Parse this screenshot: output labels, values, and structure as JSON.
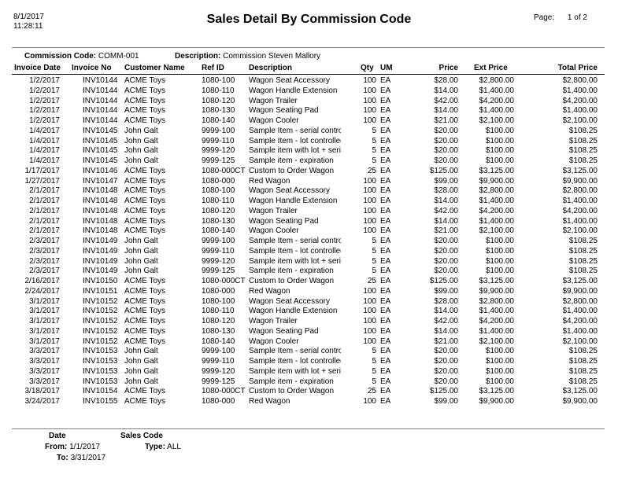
{
  "report": {
    "print_date": "8/1/2017",
    "print_time": "11:28:11",
    "title": "Sales Detail By Commission Code",
    "page_label": "Page:",
    "page_number": "1",
    "page_of": "of",
    "page_total": "2"
  },
  "commission": {
    "code_label": "Commission Code:",
    "code_value": "COMM-001",
    "desc_label": "Description:",
    "desc_value": "Commission Steven Mallory"
  },
  "columns": {
    "invoice_date": "Invoice Date",
    "invoice_no": "Invoice No",
    "customer_name": "Customer Name",
    "ref_id": "Ref ID",
    "description": "Description",
    "qty": "Qty",
    "um": "UM",
    "price": "Price",
    "ext_price": "Ext Price",
    "total_price": "Total Price"
  },
  "rows": [
    {
      "date": "1/2/2017",
      "inv": "INV10144",
      "cust": "ACME Toys",
      "ref": "1080-100",
      "desc": "Wagon Seat Accessory",
      "qty": "100",
      "um": "EA",
      "price": "$28.00",
      "ext": "$2,800.00",
      "total": "$2,800.00"
    },
    {
      "date": "1/2/2017",
      "inv": "INV10144",
      "cust": "ACME Toys",
      "ref": "1080-110",
      "desc": "Wagon Handle Extension",
      "qty": "100",
      "um": "EA",
      "price": "$14.00",
      "ext": "$1,400.00",
      "total": "$1,400.00"
    },
    {
      "date": "1/2/2017",
      "inv": "INV10144",
      "cust": "ACME Toys",
      "ref": "1080-120",
      "desc": "Wagon Trailer",
      "qty": "100",
      "um": "EA",
      "price": "$42.00",
      "ext": "$4,200.00",
      "total": "$4,200.00"
    },
    {
      "date": "1/2/2017",
      "inv": "INV10144",
      "cust": "ACME Toys",
      "ref": "1080-130",
      "desc": "Wagon Seating Pad",
      "qty": "100",
      "um": "EA",
      "price": "$14.00",
      "ext": "$1,400.00",
      "total": "$1,400.00"
    },
    {
      "date": "1/2/2017",
      "inv": "INV10144",
      "cust": "ACME Toys",
      "ref": "1080-140",
      "desc": "Wagon Cooler",
      "qty": "100",
      "um": "EA",
      "price": "$21.00",
      "ext": "$2,100.00",
      "total": "$2,100.00"
    },
    {
      "date": "1/4/2017",
      "inv": "INV10145",
      "cust": "John Galt",
      "ref": "9999-100",
      "desc": "Sample Item - serial control",
      "qty": "5",
      "um": "EA",
      "price": "$20.00",
      "ext": "$100.00",
      "total": "$108.25"
    },
    {
      "date": "1/4/2017",
      "inv": "INV10145",
      "cust": "John Galt",
      "ref": "9999-110",
      "desc": "Sample Item - lot controlled",
      "qty": "5",
      "um": "EA",
      "price": "$20.00",
      "ext": "$100.00",
      "total": "$108.25"
    },
    {
      "date": "1/4/2017",
      "inv": "INV10145",
      "cust": "John Galt",
      "ref": "9999-120",
      "desc": "Sample item with lot + serial",
      "qty": "5",
      "um": "EA",
      "price": "$20.00",
      "ext": "$100.00",
      "total": "$108.25"
    },
    {
      "date": "1/4/2017",
      "inv": "INV10145",
      "cust": "John Galt",
      "ref": "9999-125",
      "desc": "Sample item - expiration",
      "qty": "5",
      "um": "EA",
      "price": "$20.00",
      "ext": "$100.00",
      "total": "$108.25"
    },
    {
      "date": "1/17/2017",
      "inv": "INV10146",
      "cust": "ACME Toys",
      "ref": "1080-000CT",
      "desc": "Custom to Order Wagon",
      "qty": "25",
      "um": "EA",
      "price": "$125.00",
      "ext": "$3,125.00",
      "total": "$3,125.00"
    },
    {
      "date": "1/27/2017",
      "inv": "INV10147",
      "cust": "ACME Toys",
      "ref": "1080-000",
      "desc": "Red Wagon",
      "qty": "100",
      "um": "EA",
      "price": "$99.00",
      "ext": "$9,900.00",
      "total": "$9,900.00"
    },
    {
      "date": "2/1/2017",
      "inv": "INV10148",
      "cust": "ACME Toys",
      "ref": "1080-100",
      "desc": "Wagon Seat Accessory",
      "qty": "100",
      "um": "EA",
      "price": "$28.00",
      "ext": "$2,800.00",
      "total": "$2,800.00"
    },
    {
      "date": "2/1/2017",
      "inv": "INV10148",
      "cust": "ACME Toys",
      "ref": "1080-110",
      "desc": "Wagon Handle Extension",
      "qty": "100",
      "um": "EA",
      "price": "$14.00",
      "ext": "$1,400.00",
      "total": "$1,400.00"
    },
    {
      "date": "2/1/2017",
      "inv": "INV10148",
      "cust": "ACME Toys",
      "ref": "1080-120",
      "desc": "Wagon Trailer",
      "qty": "100",
      "um": "EA",
      "price": "$42.00",
      "ext": "$4,200.00",
      "total": "$4,200.00"
    },
    {
      "date": "2/1/2017",
      "inv": "INV10148",
      "cust": "ACME Toys",
      "ref": "1080-130",
      "desc": "Wagon Seating Pad",
      "qty": "100",
      "um": "EA",
      "price": "$14.00",
      "ext": "$1,400.00",
      "total": "$1,400.00"
    },
    {
      "date": "2/1/2017",
      "inv": "INV10148",
      "cust": "ACME Toys",
      "ref": "1080-140",
      "desc": "Wagon Cooler",
      "qty": "100",
      "um": "EA",
      "price": "$21.00",
      "ext": "$2,100.00",
      "total": "$2,100.00"
    },
    {
      "date": "2/3/2017",
      "inv": "INV10149",
      "cust": "John Galt",
      "ref": "9999-100",
      "desc": "Sample Item - serial control",
      "qty": "5",
      "um": "EA",
      "price": "$20.00",
      "ext": "$100.00",
      "total": "$108.25"
    },
    {
      "date": "2/3/2017",
      "inv": "INV10149",
      "cust": "John Galt",
      "ref": "9999-110",
      "desc": "Sample Item - lot controlled",
      "qty": "5",
      "um": "EA",
      "price": "$20.00",
      "ext": "$100.00",
      "total": "$108.25"
    },
    {
      "date": "2/3/2017",
      "inv": "INV10149",
      "cust": "John Galt",
      "ref": "9999-120",
      "desc": "Sample item with lot + serial",
      "qty": "5",
      "um": "EA",
      "price": "$20.00",
      "ext": "$100.00",
      "total": "$108.25"
    },
    {
      "date": "2/3/2017",
      "inv": "INV10149",
      "cust": "John Galt",
      "ref": "9999-125",
      "desc": "Sample item - expiration",
      "qty": "5",
      "um": "EA",
      "price": "$20.00",
      "ext": "$100.00",
      "total": "$108.25"
    },
    {
      "date": "2/16/2017",
      "inv": "INV10150",
      "cust": "ACME Toys",
      "ref": "1080-000CT",
      "desc": "Custom to Order Wagon",
      "qty": "25",
      "um": "EA",
      "price": "$125.00",
      "ext": "$3,125.00",
      "total": "$3,125.00"
    },
    {
      "date": "2/24/2017",
      "inv": "INV10151",
      "cust": "ACME Toys",
      "ref": "1080-000",
      "desc": "Red Wagon",
      "qty": "100",
      "um": "EA",
      "price": "$99.00",
      "ext": "$9,900.00",
      "total": "$9,900.00"
    },
    {
      "date": "3/1/2017",
      "inv": "INV10152",
      "cust": "ACME Toys",
      "ref": "1080-100",
      "desc": "Wagon Seat Accessory",
      "qty": "100",
      "um": "EA",
      "price": "$28.00",
      "ext": "$2,800.00",
      "total": "$2,800.00"
    },
    {
      "date": "3/1/2017",
      "inv": "INV10152",
      "cust": "ACME Toys",
      "ref": "1080-110",
      "desc": "Wagon Handle Extension",
      "qty": "100",
      "um": "EA",
      "price": "$14.00",
      "ext": "$1,400.00",
      "total": "$1,400.00"
    },
    {
      "date": "3/1/2017",
      "inv": "INV10152",
      "cust": "ACME Toys",
      "ref": "1080-120",
      "desc": "Wagon Trailer",
      "qty": "100",
      "um": "EA",
      "price": "$42.00",
      "ext": "$4,200.00",
      "total": "$4,200.00"
    },
    {
      "date": "3/1/2017",
      "inv": "INV10152",
      "cust": "ACME Toys",
      "ref": "1080-130",
      "desc": "Wagon Seating Pad",
      "qty": "100",
      "um": "EA",
      "price": "$14.00",
      "ext": "$1,400.00",
      "total": "$1,400.00"
    },
    {
      "date": "3/1/2017",
      "inv": "INV10152",
      "cust": "ACME Toys",
      "ref": "1080-140",
      "desc": "Wagon Cooler",
      "qty": "100",
      "um": "EA",
      "price": "$21.00",
      "ext": "$2,100.00",
      "total": "$2,100.00"
    },
    {
      "date": "3/3/2017",
      "inv": "INV10153",
      "cust": "John Galt",
      "ref": "9999-100",
      "desc": "Sample Item - serial control",
      "qty": "5",
      "um": "EA",
      "price": "$20.00",
      "ext": "$100.00",
      "total": "$108.25"
    },
    {
      "date": "3/3/2017",
      "inv": "INV10153",
      "cust": "John Galt",
      "ref": "9999-110",
      "desc": "Sample Item - lot controlled",
      "qty": "5",
      "um": "EA",
      "price": "$20.00",
      "ext": "$100.00",
      "total": "$108.25"
    },
    {
      "date": "3/3/2017",
      "inv": "INV10153",
      "cust": "John Galt",
      "ref": "9999-120",
      "desc": "Sample item with lot + serial",
      "qty": "5",
      "um": "EA",
      "price": "$20.00",
      "ext": "$100.00",
      "total": "$108.25"
    },
    {
      "date": "3/3/2017",
      "inv": "INV10153",
      "cust": "John Galt",
      "ref": "9999-125",
      "desc": "Sample item - expiration",
      "qty": "5",
      "um": "EA",
      "price": "$20.00",
      "ext": "$100.00",
      "total": "$108.25"
    },
    {
      "date": "3/18/2017",
      "inv": "INV10154",
      "cust": "ACME Toys",
      "ref": "1080-000CT",
      "desc": "Custom to Order Wagon",
      "qty": "25",
      "um": "EA",
      "price": "$125.00",
      "ext": "$3,125.00",
      "total": "$3,125.00"
    },
    {
      "date": "3/24/2017",
      "inv": "INV10155",
      "cust": "ACME Toys",
      "ref": "1080-000",
      "desc": "Red Wagon",
      "qty": "100",
      "um": "EA",
      "price": "$99.00",
      "ext": "$9,900.00",
      "total": "$9,900.00"
    }
  ],
  "footer": {
    "date_heading": "Date",
    "from_label": "From:",
    "from_value": "1/1/2017",
    "to_label": "To:",
    "to_value": "3/31/2017",
    "sales_code_heading": "Sales Code",
    "type_label": "Type:",
    "type_value": "ALL"
  }
}
